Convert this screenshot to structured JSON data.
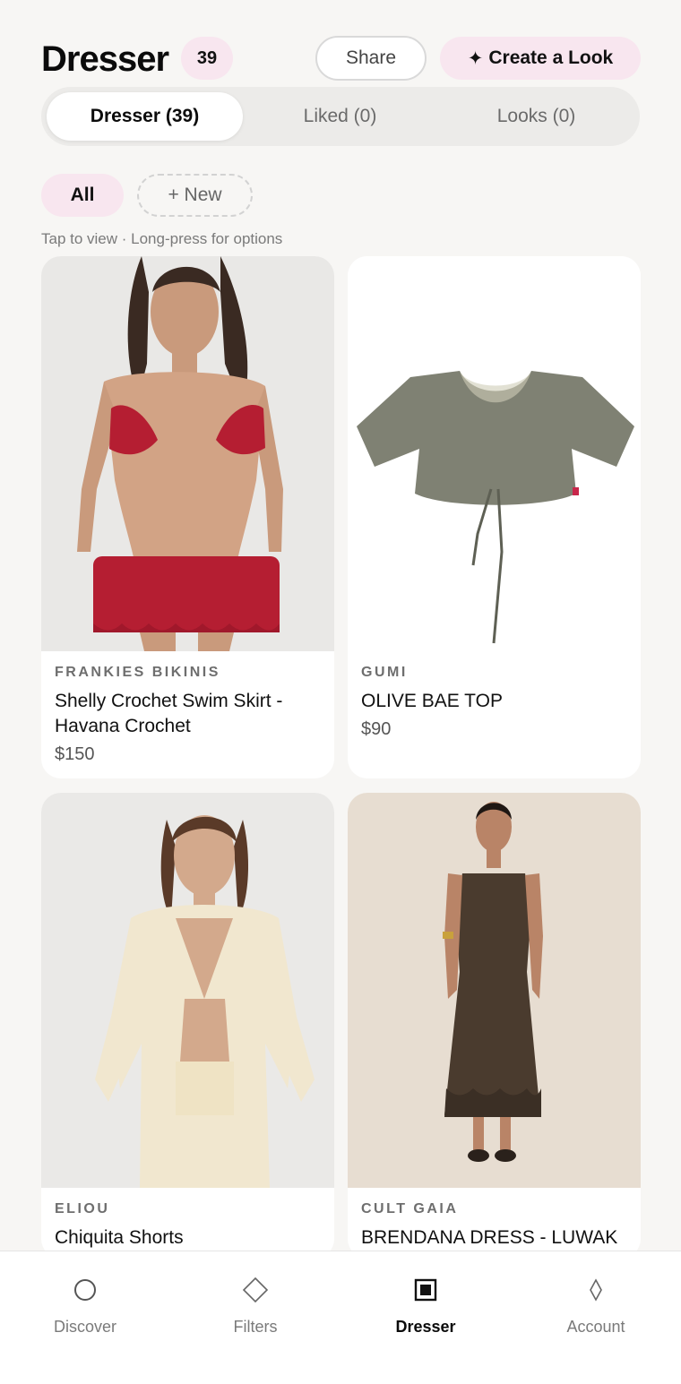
{
  "header": {
    "title": "Dresser",
    "count": "39",
    "share_label": "Share",
    "create_icon": "✦",
    "create_label": "Create a Look"
  },
  "tabs": [
    {
      "label": "Dresser (39)",
      "active": true
    },
    {
      "label": "Liked (0)",
      "active": false
    },
    {
      "label": "Looks (0)",
      "active": false
    }
  ],
  "filters": {
    "all_label": "All",
    "new_label": "+ New"
  },
  "hint": "Tap to view · Long-press for options",
  "products": [
    {
      "brand": "FRANKIES BIKINIS",
      "name": "Shelly Crochet Swim Skirt - Havana Crochet",
      "price": "$150"
    },
    {
      "brand": "GUMI",
      "name": "OLIVE BAE TOP",
      "price": "$90"
    },
    {
      "brand": "ELIOU",
      "name": "Chiquita Shorts",
      "price": ""
    },
    {
      "brand": "CULT GAIA",
      "name": "BRENDANA DRESS - LUWAK",
      "price": ""
    }
  ],
  "nav": [
    {
      "label": "Discover",
      "icon": "circle-icon",
      "active": false
    },
    {
      "label": "Filters",
      "icon": "diamond-icon",
      "active": false
    },
    {
      "label": "Dresser",
      "icon": "square-icon",
      "active": true
    },
    {
      "label": "Account",
      "icon": "lozenge-icon",
      "active": false
    }
  ],
  "colors": {
    "accent_pink": "#f8e6ef",
    "background": "#f7f6f4"
  }
}
